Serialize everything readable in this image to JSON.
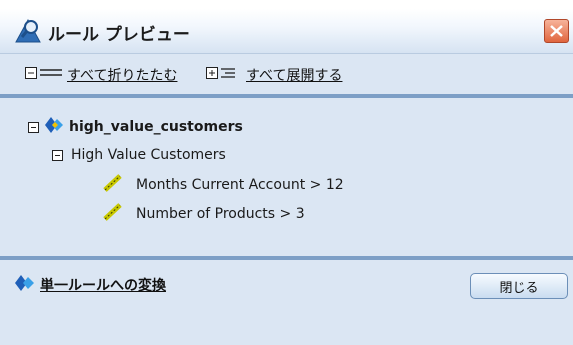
{
  "dialog": {
    "title": "ルール プレビュー",
    "close_icon": "close-icon"
  },
  "toolbar": {
    "collapse_all": "すべて折りたたむ",
    "expand_all": "すべて展開する"
  },
  "tree": {
    "root": {
      "label": "high_value_customers",
      "icon": "ruleset-diamond-icon"
    },
    "rule": {
      "label": "High Value Customers"
    },
    "conditions": [
      {
        "label": "Months Current Account > 12",
        "icon": "ruler-icon"
      },
      {
        "label": "Number of Products > 3",
        "icon": "ruler-icon"
      }
    ]
  },
  "footer": {
    "convert_label": "単一ルールへの変換",
    "close_button": "閉じる"
  },
  "colors": {
    "panel_bg": "#dbe6f3",
    "separator": "#7d9fc6",
    "close_red": "#e0653e"
  }
}
